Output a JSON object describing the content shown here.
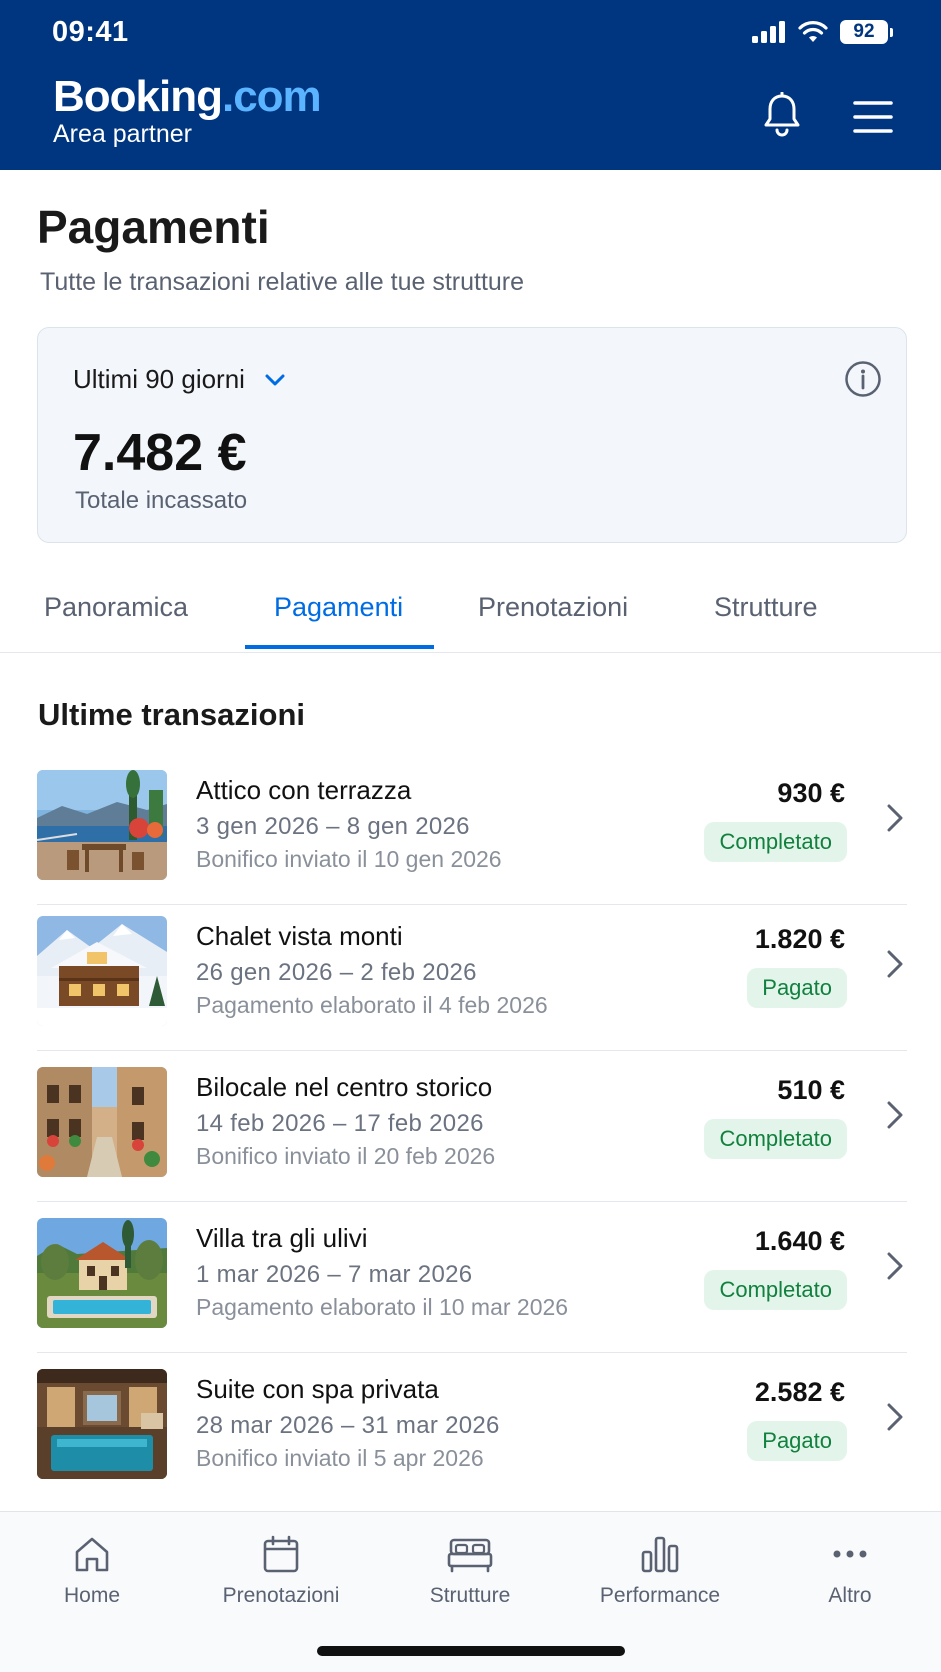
{
  "status_bar": {
    "time": "09:41",
    "battery": "92"
  },
  "header": {
    "brand_main": "Booking",
    "brand_suffix": ".com",
    "brand_sub": "Area partner"
  },
  "page": {
    "title": "Pagamenti",
    "subtitle": "Tutte le transazioni relative alle tue strutture"
  },
  "summary": {
    "period": "Ultimi 90 giorni",
    "total": "7.482 €",
    "total_label": "Totale incassato"
  },
  "tabs": [
    {
      "label": "Panoramica"
    },
    {
      "label": "Pagamenti",
      "active": true
    },
    {
      "label": "Prenotazioni"
    },
    {
      "label": "Strutture"
    }
  ],
  "section_title": "Ultime transazioni",
  "transactions": [
    {
      "name": "Attico con terrazza",
      "dates": "3 gen 2026  –  8 gen 2026",
      "note": "Bonifico inviato il 10 gen 2026",
      "amount": "930 €",
      "status": "Completato",
      "image": "terrace-sea-view"
    },
    {
      "name": "Chalet vista monti",
      "dates": "26 gen 2026  –  2 feb 2026",
      "note": "Pagamento elaborato il 4 feb 2026",
      "amount": "1.820 €",
      "status": "Pagato",
      "image": "snowy-chalet"
    },
    {
      "name": "Bilocale nel centro storico",
      "dates": "14 feb 2026  –  17 feb 2026",
      "note": "Bonifico inviato il 20 feb 2026",
      "amount": "510 €",
      "status": "Completato",
      "image": "old-town-street"
    },
    {
      "name": "Villa tra gli ulivi",
      "dates": "1 mar 2026  –  7 mar 2026",
      "note": "Pagamento elaborato il 10 mar 2026",
      "amount": "1.640 €",
      "status": "Completato",
      "image": "villa-pool"
    },
    {
      "name": "Suite con spa privata",
      "dates": "28 mar 2026  –  31 mar 2026",
      "note": "Bonifico inviato il 5 apr 2026",
      "amount": "2.582 €",
      "status": "Pagato",
      "image": "spa-suite"
    }
  ],
  "bottom_nav": [
    {
      "label": "Home",
      "icon": "home-icon"
    },
    {
      "label": "Prenotazioni",
      "icon": "calendar-icon"
    },
    {
      "label": "Strutture",
      "icon": "bed-icon"
    },
    {
      "label": "Performance",
      "icon": "bar-chart-icon"
    },
    {
      "label": "Altro",
      "icon": "more-icon"
    }
  ],
  "colors": {
    "brand_blue": "#003580",
    "accent": "#006ce4",
    "success_bg": "#e3f5ea",
    "success_text": "#12803e"
  }
}
